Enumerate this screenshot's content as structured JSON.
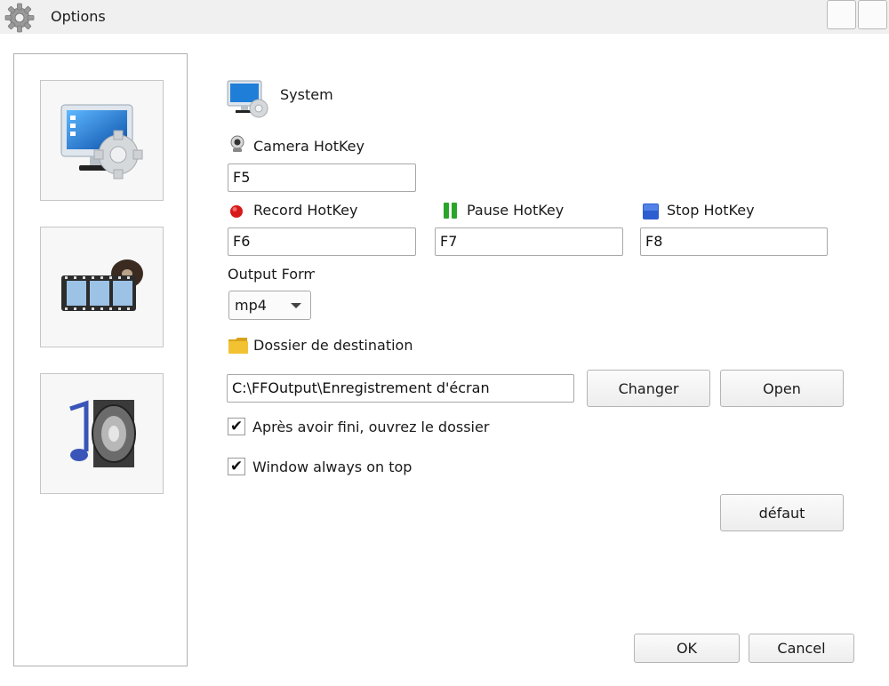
{
  "window": {
    "title": "Options",
    "app_icon": "gear-icon"
  },
  "sidebar": {
    "items": [
      {
        "name": "system",
        "icon": "monitor-gear-icon"
      },
      {
        "name": "video",
        "icon": "film-reel-icon"
      },
      {
        "name": "audio",
        "icon": "speaker-music-icon"
      }
    ]
  },
  "main": {
    "section_title": "System",
    "camera_hotkey": {
      "label": "Camera HotKey",
      "value": "F5",
      "icon": "webcam-icon"
    },
    "record_hotkey": {
      "label": "Record HotKey",
      "value": "F6",
      "icon": "record-dot-icon",
      "color": "#d61a1a"
    },
    "pause_hotkey": {
      "label": "Pause HotKey",
      "value": "F7",
      "icon": "pause-icon",
      "color": "#2aa52a"
    },
    "stop_hotkey": {
      "label": "Stop HotKey",
      "value": "F8",
      "icon": "stop-square-icon",
      "color": "#2b5fd0"
    },
    "output_format": {
      "label": "Output Forma",
      "selected": "mp4"
    },
    "destination": {
      "label": "Dossier de destination",
      "icon": "folder-icon",
      "path": "C:\\FFOutput\\Enregistrement d'écran",
      "change_label": "Changer",
      "open_label": "Open"
    },
    "open_after_finish": {
      "label": "Après avoir fini, ouvrez le dossier",
      "checked": true
    },
    "always_on_top": {
      "label": "Window always on top",
      "checked": true
    },
    "default_label": "défaut",
    "ok_label": "OK",
    "cancel_label": "Cancel"
  }
}
